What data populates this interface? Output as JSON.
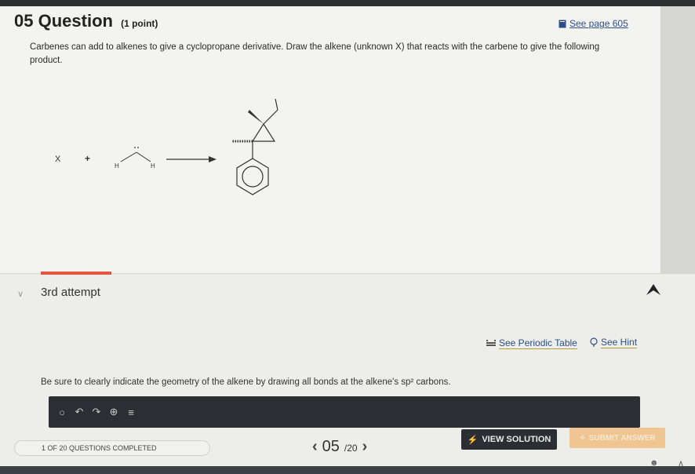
{
  "question": {
    "number": "05",
    "title_word": "Question",
    "points": "(1 point)",
    "see_page": "See page 605",
    "text": "Carbenes can add to alkenes to give a cyclopropane derivative. Draw the alkene (unknown X) that reacts with the carbene to give the following product.",
    "scheme": {
      "reactant_x": "X",
      "plus": "+",
      "h_left": "H",
      "h_right": "H"
    }
  },
  "attempt": {
    "label": "3rd attempt",
    "periodic_table": "See Periodic Table",
    "hint": "See Hint",
    "instruction": "Be sure to clearly indicate the geometry of the alkene by drawing all bonds at the alkene's sp² carbons."
  },
  "editor_tools": [
    "ring-icon",
    "undo-icon",
    "redo-icon",
    "zoom-icon",
    "list-icon"
  ],
  "footer": {
    "progress": "1 OF 20 QUESTIONS COMPLETED",
    "page_current": "05",
    "page_total": "/20",
    "view_solution": "VIEW SOLUTION",
    "submit": "SUBMIT ANSWER"
  },
  "colors": {
    "accent": "#e2573e",
    "link": "#2b4f86",
    "dark_button": "#2c2e33",
    "submit_disabled": "#efc591"
  }
}
